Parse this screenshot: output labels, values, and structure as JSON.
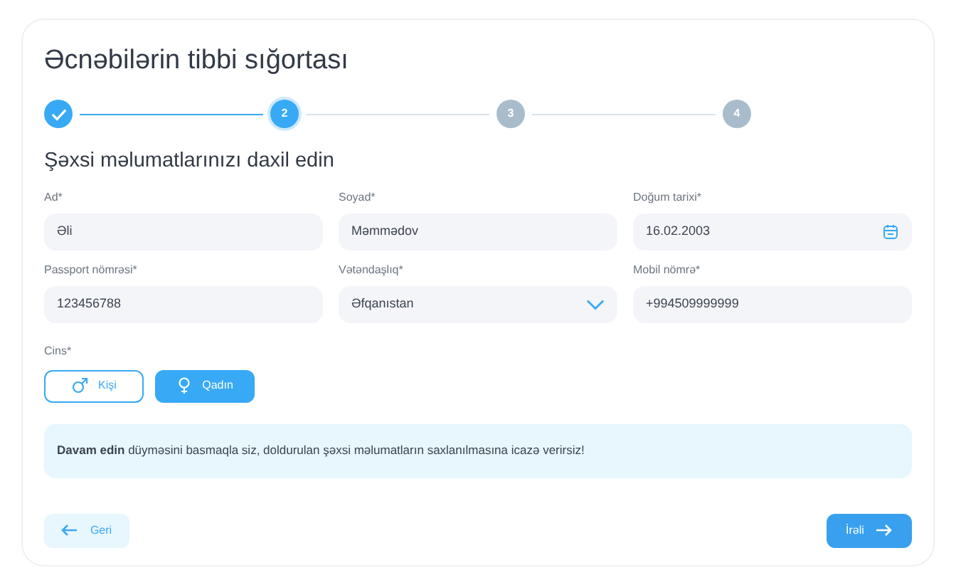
{
  "title": "Əcnəbilərin tibbi sığortası",
  "steps": [
    {
      "done": true,
      "selected": false
    },
    {
      "label": "2",
      "done": false,
      "selected": true
    },
    {
      "label": "3",
      "done": false,
      "selected": false
    },
    {
      "label": "4",
      "done": false,
      "selected": false
    }
  ],
  "section_title": "Şəxsi məlumatlarınızı daxil edin",
  "fields": [
    {
      "label": "Ad*",
      "value": "Əli",
      "kind": "text"
    },
    {
      "label": "Soyad*",
      "value": "Məmmədov",
      "kind": "text"
    },
    {
      "label": "Doğum tarixi*",
      "value": "16.02.2003",
      "kind": "date"
    },
    {
      "label": "Passport nömrəsi*",
      "value": "123456788",
      "kind": "text"
    },
    {
      "label": "Vətəndaşlıq*",
      "value": "Əfqanıstan",
      "kind": "select"
    },
    {
      "label": "Mobil nömrə*",
      "value": "+994509999999",
      "kind": "text"
    }
  ],
  "gender": {
    "label": "Cins*",
    "options": [
      {
        "label": "Kişi",
        "kind": "male",
        "selected": false
      },
      {
        "label": "Qadın",
        "kind": "female",
        "selected": true
      }
    ]
  },
  "notice": "**Davam edin** düyməsini basmaqla siz, doldurulan şəxsi məlumatların saxlanılmasına icazə verirsiz!",
  "back_button": "Geri",
  "next_button": "İrəli"
}
